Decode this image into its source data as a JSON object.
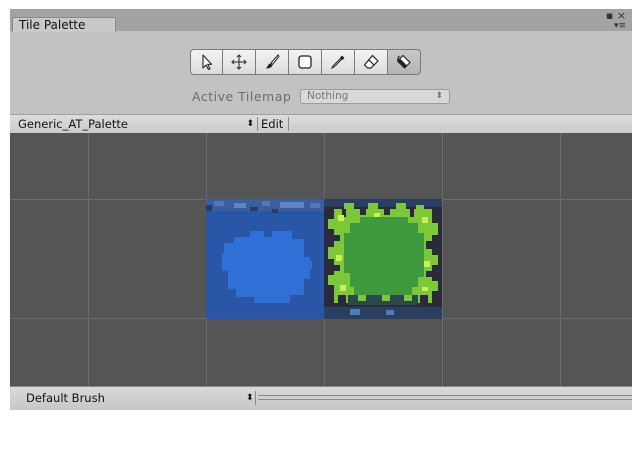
{
  "window": {
    "tab_title": "Tile Palette",
    "maximize_glyph": "▪",
    "close_glyph": "×",
    "menu_glyph": "▾≡"
  },
  "toolbar": {
    "tools": [
      {
        "name": "select-icon",
        "active": false
      },
      {
        "name": "move-icon",
        "active": false
      },
      {
        "name": "paintbrush-icon",
        "active": false
      },
      {
        "name": "box-fill-icon",
        "active": false
      },
      {
        "name": "picker-icon",
        "active": false
      },
      {
        "name": "eraser-icon",
        "active": false
      },
      {
        "name": "fill-bucket-icon",
        "active": true
      }
    ]
  },
  "active_tilemap": {
    "label": "Active Tilemap",
    "value": "Nothing",
    "arrow": "⬍"
  },
  "palette_header": {
    "palette_name": "Generic_AT_Palette",
    "arrow": "⬍",
    "edit_label": "Edit"
  },
  "tiles": [
    {
      "name": "water-tile",
      "color": "#2f63c4"
    },
    {
      "name": "grass-tile",
      "color": "#3f9a3e"
    }
  ],
  "footer": {
    "brush_name": "Default Brush",
    "arrow": "⬍"
  },
  "colors": {
    "window_bg": "#c2c2c2",
    "grid_bg": "#555555",
    "grid_line": "#6b6b6b"
  }
}
